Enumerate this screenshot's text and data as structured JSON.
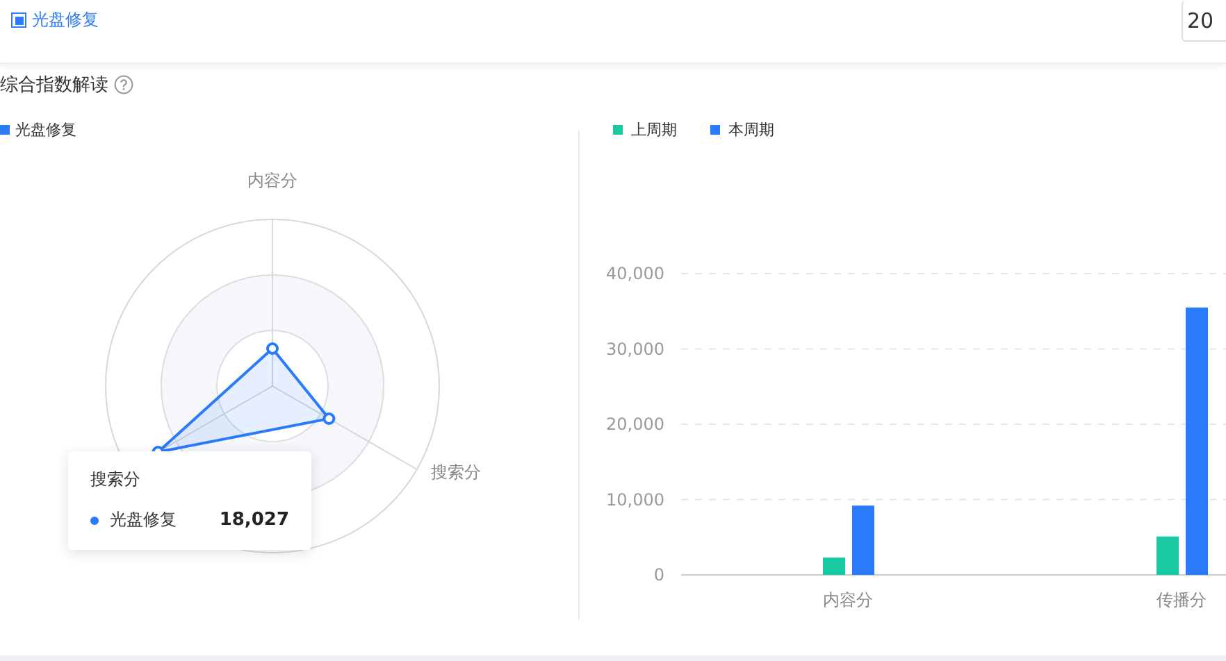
{
  "filter": {
    "label": "光盘修复",
    "checked": true
  },
  "date_field": {
    "value": "20"
  },
  "section": {
    "title": "综合指数解读"
  },
  "radar": {
    "legend": [
      {
        "label": "光盘修复",
        "color": "#2a7bfb"
      }
    ],
    "axes": [
      "内容分",
      "搜索分"
    ],
    "tooltip": {
      "title": "搜索分",
      "series": "光盘修复",
      "value": "18,027"
    }
  },
  "bar_chart": {
    "chart_data": {
      "type": "bar",
      "categories": [
        "内容分",
        "传播分"
      ],
      "series": [
        {
          "name": "上周期",
          "color": "#19c9a0",
          "values": [
            2300,
            5100
          ]
        },
        {
          "name": "本周期",
          "color": "#2a7bfb",
          "values": [
            9200,
            35500
          ]
        }
      ],
      "ylim": [
        0,
        40000
      ],
      "grid": true,
      "yticks": [
        {
          "value": 0,
          "label": "0"
        },
        {
          "value": 10000,
          "label": "10,000"
        },
        {
          "value": 20000,
          "label": "20,000"
        },
        {
          "value": 30000,
          "label": "30,000"
        },
        {
          "value": 40000,
          "label": "40,000"
        }
      ]
    }
  }
}
